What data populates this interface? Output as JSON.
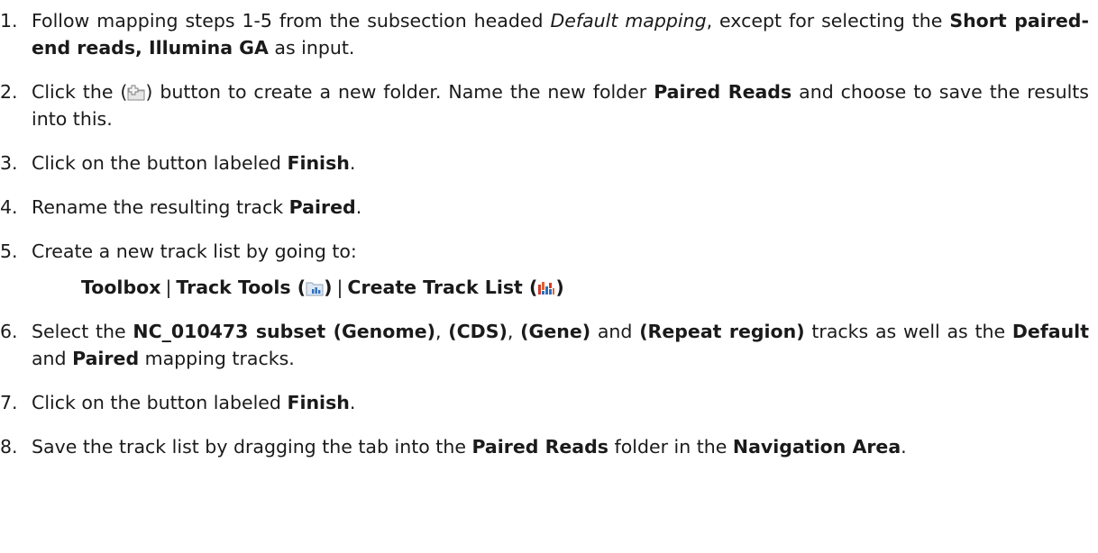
{
  "steps": [
    {
      "num": "1.",
      "t1": "Follow mapping steps 1-5 from the subsection headed ",
      "i1": "Default mapping",
      "t2": ", except for selecting the ",
      "b1": "Short paired-end reads, Illumina GA",
      "t3": " as input."
    },
    {
      "num": "2.",
      "t1": "Click the (",
      "icon": "new-folder-icon",
      "t2": ") button to create a new folder. Name the new folder ",
      "b1": "Paired Reads",
      "t3": " and choose to save the results into this."
    },
    {
      "num": "3.",
      "t1": "Click on the button labeled ",
      "b1": "Finish",
      "t2": "."
    },
    {
      "num": "4.",
      "t1": "Rename the resulting track ",
      "b1": "Paired",
      "t2": "."
    },
    {
      "num": "5.",
      "t1": "Create a new track list by going to:"
    },
    {
      "num": "6.",
      "t1": "Select the ",
      "b1": "NC_010473 subset (Genome)",
      "t2": ", ",
      "b2": "(CDS)",
      "t3": ", ",
      "b3": "(Gene)",
      "t4": " and ",
      "b4": "(Repeat region)",
      "t5": " tracks as well as the ",
      "b5": "Default",
      "t6": " and ",
      "b6": "Paired",
      "t7": " mapping tracks."
    },
    {
      "num": "7.",
      "t1": "Click on the button labeled ",
      "b1": "Finish",
      "t2": "."
    },
    {
      "num": "8.",
      "t1": "Save the track list by dragging the tab into the ",
      "b1": "Paired Reads",
      "t2": " folder in the ",
      "b2": "Navigation Area",
      "t3": "."
    }
  ],
  "menu_path": {
    "item1": "Toolbox",
    "sep": "|",
    "item2": "Track Tools (",
    "item2_icon": "track-tools-icon",
    "item2_end": ")",
    "item3": "Create Track List (",
    "item3_icon": "create-track-list-icon",
    "item3_end": ")"
  }
}
